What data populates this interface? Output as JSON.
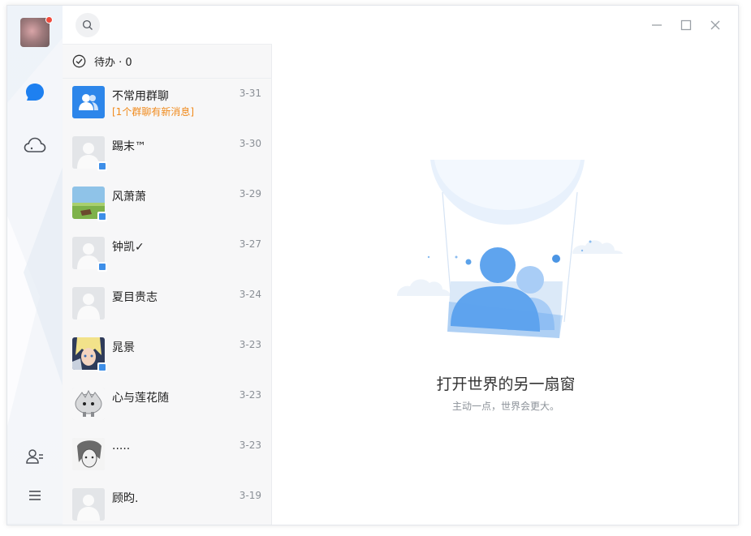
{
  "nav": {
    "avatar": "user-avatar",
    "unread_dot": true,
    "items": [
      {
        "name": "messages",
        "icon": "chat-bubble-icon",
        "active": true
      },
      {
        "name": "cloud",
        "icon": "cloud-icon",
        "active": false
      },
      {
        "name": "contacts",
        "icon": "contacts-icon",
        "active": false
      },
      {
        "name": "menu",
        "icon": "menu-icon",
        "active": false
      }
    ]
  },
  "search": {
    "icon": "search-icon"
  },
  "todo": {
    "label": "待办 · 0"
  },
  "conversations": [
    {
      "name": "不常用群聊",
      "sub": "[1个群聊有新消息]",
      "date": "3-31",
      "avatar": "group"
    },
    {
      "name": "踢末™",
      "sub": "",
      "date": "3-30",
      "avatar": "default"
    },
    {
      "name": "风萧萧",
      "sub": "",
      "date": "3-29",
      "avatar": "landscape"
    },
    {
      "name": "钟凯✓",
      "sub": "",
      "date": "3-27",
      "avatar": "default"
    },
    {
      "name": "夏目贵志",
      "sub": "",
      "date": "3-24",
      "avatar": "default"
    },
    {
      "name": "晁景",
      "sub": "",
      "date": "3-23",
      "avatar": "anime"
    },
    {
      "name": "心与莲花随",
      "sub": "",
      "date": "3-23",
      "avatar": "mascot"
    },
    {
      "name": ".....",
      "sub": "",
      "date": "3-23",
      "avatar": "sketch"
    },
    {
      "name": "顾昀.",
      "sub": "",
      "date": "3-19",
      "avatar": "default"
    }
  ],
  "main": {
    "title": "打开世界的另一扇窗",
    "subtitle": "主动一点，世界会更大。"
  },
  "window_controls": [
    "minimize-icon",
    "maximize-icon",
    "close-icon"
  ],
  "colors": {
    "accent": "#1e80f0",
    "notice": "#f08a1c",
    "badge": "#3d8ee8",
    "unread": "#f04a3c"
  }
}
